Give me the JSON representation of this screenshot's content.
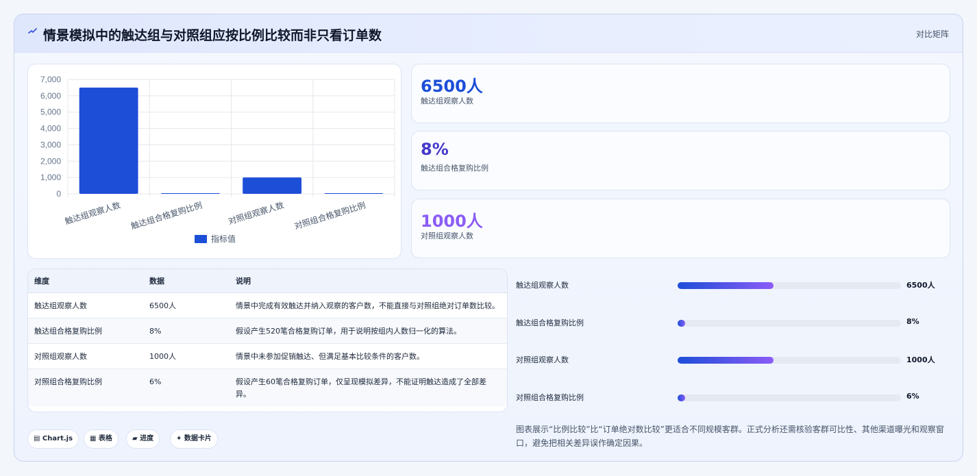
{
  "header": {
    "title": "情景模拟中的触达组与对照组应按比例比较而非只看订单数",
    "tag": "对比矩阵"
  },
  "metrics": [
    {
      "value": "6500人",
      "label": "触达组观察人数",
      "color": "#1d4ed8"
    },
    {
      "value": "8%",
      "label": "触达组合格复购比例",
      "color": "#4338ca"
    },
    {
      "value": "1000人",
      "label": "对照组观察人数",
      "color": "#8b5cf6"
    }
  ],
  "chart_data": {
    "type": "bar",
    "categories": [
      "触达组观察人数",
      "触达组合格复购比例",
      "对照组观察人数",
      "对照组合格复购比例"
    ],
    "series": [
      {
        "name": "指标值",
        "values": [
          6500,
          8,
          1000,
          6
        ],
        "color": "#1d4ed8"
      }
    ],
    "ylim": [
      0,
      7000
    ],
    "yticks": [
      "7,000",
      "6,000",
      "5,000",
      "4,000",
      "3,000",
      "2,000",
      "1,000",
      "0"
    ],
    "legend": "bottom",
    "grid": true
  },
  "table": {
    "headers": [
      "维度",
      "数据",
      "说明"
    ],
    "rows": [
      [
        "触达组观察人数",
        "6500人",
        "情景中完成有效触达并纳入观察的客户数，不能直接与对照组绝对订单数比较。"
      ],
      [
        "触达组合格复购比例",
        "8%",
        "假设产生520笔合格复购订单，用于说明按组内人数归一化的算法。"
      ],
      [
        "对照组观察人数",
        "1000人",
        "情景中未参加促销触达、但满足基本比较条件的客户数。"
      ],
      [
        "对照组合格复购比例",
        "6%",
        "假设产生60笔合格复购订单，仅呈现模拟差异，不能证明触达造成了全部差异。"
      ]
    ]
  },
  "progress": [
    {
      "label": "触达组观察人数",
      "value": "6500人",
      "fraction": 0.43
    },
    {
      "label": "触达组合格复购比例",
      "value": "8%",
      "fraction": 0.02
    },
    {
      "label": "对照组观察人数",
      "value": "1000人",
      "fraction": 0.43
    },
    {
      "label": "对照组合格复购比例",
      "value": "6%",
      "fraction": 0.02
    }
  ],
  "chips": [
    "▤ Chart.js",
    "▦ 表格",
    "▰ 进度",
    "✦ 数据卡片"
  ],
  "note": "图表展示“比例比较”比“订单绝对数比较”更适合不同规模客群。正式分析还需核验客群可比性、其他渠道曝光和观察窗口，避免把相关差异误作确定因果。"
}
